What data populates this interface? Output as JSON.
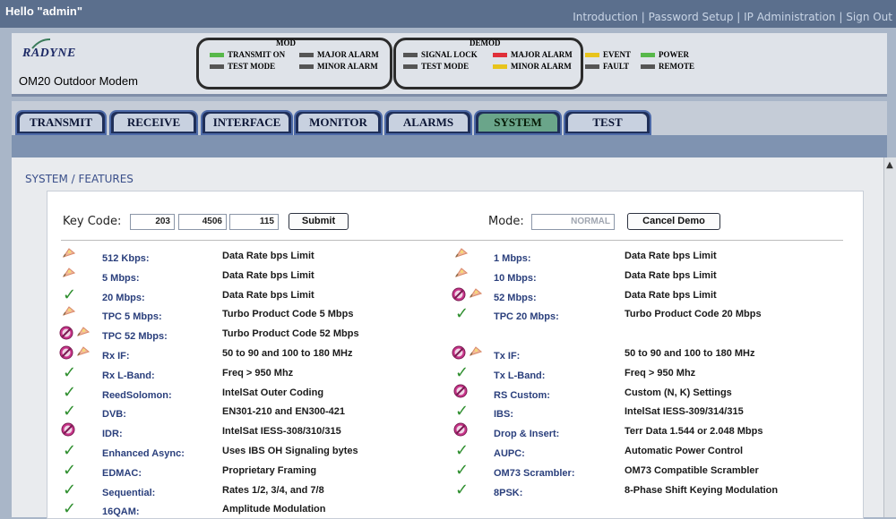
{
  "topbar": {
    "greeting": "Hello \"admin\"",
    "nav": [
      "Introduction",
      "Password Setup",
      "IP Administration",
      "Sign Out"
    ],
    "separator": "|"
  },
  "header": {
    "logo_text": "RADYNE",
    "model": "OM20 Outdoor Modem",
    "mod": {
      "title": "MOD",
      "leds": [
        {
          "label": "TRANSMIT ON",
          "color": "#57b84a"
        },
        {
          "label": "MAJOR ALARM",
          "color": "#555555"
        },
        {
          "label": "TEST MODE",
          "color": "#555555"
        },
        {
          "label": "MINOR ALARM",
          "color": "#555555"
        }
      ]
    },
    "demod": {
      "title": "DEMOD",
      "leds": [
        {
          "label": "SIGNAL LOCK",
          "color": "#555555"
        },
        {
          "label": "MAJOR ALARM",
          "color": "#e0303a"
        },
        {
          "label": "TEST MODE",
          "color": "#555555"
        },
        {
          "label": "MINOR ALARM",
          "color": "#e8c41c"
        }
      ]
    },
    "misc": [
      {
        "label": "EVENT",
        "color": "#e8c41c"
      },
      {
        "label": "POWER",
        "color": "#57b84a"
      },
      {
        "label": "FAULT",
        "color": "#555555"
      },
      {
        "label": "REMOTE",
        "color": "#555555"
      }
    ]
  },
  "tabs": [
    "TRANSMIT",
    "RECEIVE",
    "INTERFACE",
    "MONITOR",
    "ALARMS",
    "SYSTEM",
    "TEST"
  ],
  "active_tab": "SYSTEM",
  "breadcrumb": "SYSTEM / FEATURES",
  "keycode": {
    "label": "Key Code:",
    "values": [
      "203",
      "4506",
      "115"
    ],
    "submit_label": "Submit"
  },
  "mode": {
    "label": "Mode:",
    "value": "NORMAL",
    "cancel_label": "Cancel Demo"
  },
  "features_left": [
    {
      "name": "512 Kbps:",
      "desc": "Data Rate bps Limit",
      "status": "demo"
    },
    {
      "name": "5 Mbps:",
      "desc": "Data Rate bps Limit",
      "status": "demo"
    },
    {
      "name": "20 Mbps:",
      "desc": "Data Rate bps Limit",
      "status": "enabled"
    },
    {
      "name": "TPC 5 Mbps:",
      "desc": "Turbo Product Code 5 Mbps",
      "status": "demo"
    },
    {
      "name": "TPC 52 Mbps:",
      "desc": "Turbo Product Code 52 Mbps",
      "status": "disabled-demo"
    },
    {
      "name": "Rx IF:",
      "desc": "50 to 90 and 100 to 180 MHz",
      "status": "disabled-demo"
    },
    {
      "name": "Rx L-Band:",
      "desc": "Freq > 950 Mhz",
      "status": "enabled"
    },
    {
      "name": "ReedSolomon:",
      "desc": "IntelSat Outer Coding",
      "status": "enabled"
    },
    {
      "name": "DVB:",
      "desc": "EN301-210 and EN300-421",
      "status": "enabled"
    },
    {
      "name": "IDR:",
      "desc": "IntelSat IESS-308/310/315",
      "status": "disabled"
    },
    {
      "name": "Enhanced Async:",
      "desc": "Uses IBS OH Signaling bytes",
      "status": "enabled"
    },
    {
      "name": "EDMAC:",
      "desc": "Proprietary Framing",
      "status": "enabled"
    },
    {
      "name": "Sequential:",
      "desc": "Rates 1/2, 3/4, and 7/8",
      "status": "enabled"
    },
    {
      "name": "16QAM:",
      "desc": "Amplitude Modulation",
      "status": "enabled"
    }
  ],
  "features_right": [
    {
      "name": "1 Mbps:",
      "desc": "Data Rate bps Limit",
      "status": "demo"
    },
    {
      "name": "10 Mbps:",
      "desc": "Data Rate bps Limit",
      "status": "demo"
    },
    {
      "name": "52 Mbps:",
      "desc": "Data Rate bps Limit",
      "status": "disabled-demo"
    },
    {
      "name": "TPC 20 Mbps:",
      "desc": "Turbo Product Code 20 Mbps",
      "status": "enabled"
    },
    {
      "name": "",
      "desc": "",
      "status": "none"
    },
    {
      "name": "Tx IF:",
      "desc": "50 to 90 and 100 to 180 MHz",
      "status": "disabled-demo"
    },
    {
      "name": "Tx L-Band:",
      "desc": "Freq > 950 Mhz",
      "status": "enabled"
    },
    {
      "name": "RS Custom:",
      "desc": "Custom (N, K) Settings",
      "status": "disabled"
    },
    {
      "name": "IBS:",
      "desc": "IntelSat IESS-309/314/315",
      "status": "enabled"
    },
    {
      "name": "Drop & Insert:",
      "desc": "Terr Data 1.544 or 2.048 Mbps",
      "status": "disabled"
    },
    {
      "name": "AUPC:",
      "desc": "Automatic Power Control",
      "status": "enabled"
    },
    {
      "name": "OM73 Scrambler:",
      "desc": "OM73 Compatible Scrambler",
      "status": "enabled"
    },
    {
      "name": "8PSK:",
      "desc": "8-Phase Shift Keying Modulation",
      "status": "enabled"
    }
  ]
}
